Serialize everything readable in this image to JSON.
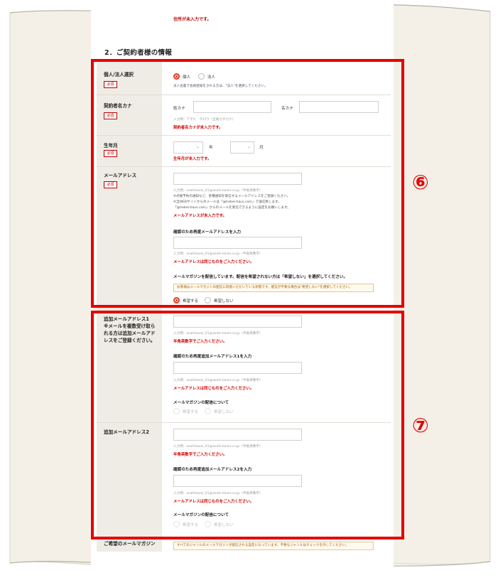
{
  "top_error": "住所が未入力です。",
  "section_title": "2．ご契約者様の情報",
  "required_label": "必須",
  "rows": {
    "type": {
      "label": "個人/法人選択",
      "options": [
        "個人",
        "法人"
      ],
      "selected": "個人",
      "note": "法人名義で会員登録をされる方は、\"法人\"を選択してください。"
    },
    "kana": {
      "label": "契約者名カナ",
      "sei_label": "姓カナ",
      "mei_label": "名カナ",
      "hint": "入力例：アサヒ　タロウ（全角カタカナ）",
      "error": "契約者名カナが未入力です。"
    },
    "birth": {
      "label": "生年月",
      "year_unit": "年",
      "month_unit": "月",
      "error": "生年月が未入力です。"
    },
    "email": {
      "label": "メールアドレス",
      "hint": "入力例：asahikasei_01@asahi-kasei.co.jp（半角英数字）",
      "notes": [
        "※点検予約の通知など、各種通知を受信するメールアドレスをご登録ください。",
        "※当WEBサイトからのメールは「@hebel-haus.com」で送信致します。",
        "「@hebel-haus.com」からのメールを受信できるように設定をお願いします。"
      ],
      "error": "メールアドレスが未入力です。",
      "confirm_label": "確認のため再度メールアドレスを入力",
      "confirm_hint": "入力例：asahikasei_01@asahi-kasei.co.jp（半角英数字）",
      "confirm_error": "メールアドレスは同じものをご入力ください。",
      "magazine_label": "メールマガジンを配信しています。配信を希望されない方は「希望しない」を選択してください。",
      "magazine_notice": "お客様はメールマガジンの配信に同意いただいている状態です。配信が不要な場合は\"希望しない\"を選択してください。",
      "magazine_options": [
        "希望する",
        "希望しない"
      ],
      "magazine_selected": "希望する"
    },
    "extra1": {
      "label_lines": [
        "追加メールアドレス1",
        "※メールを複数受け取ら",
        "れる方は追加メールアド",
        "レスをご登録ください。"
      ],
      "hint": "入力例：asahikasei_01@asahi-kasei.co.jp（半角英数字）",
      "error": "半角英数字でご入力ください。",
      "confirm_label": "確認のため再度追加メールアドレス1を入力",
      "confirm_hint": "入力例：asahikasei_01@asahi-kasei.co.jp（半角英数字）",
      "confirm_error": "メールアドレスは同じものをご入力ください。",
      "magazine_label": "メールマガジンの配信について",
      "magazine_options": [
        "希望する",
        "希望しない"
      ]
    },
    "extra2": {
      "label": "追加メールアドレス2",
      "hint": "入力例：asahikasei_01@asahi-kasei.co.jp（半角英数字）",
      "error": "半角英数字でご入力ください。",
      "confirm_label": "確認のため再度追加メールアドレス2を入力",
      "confirm_hint": "入力例：asahikasei_01@asahi-kasei.co.jp（半角英数字）",
      "confirm_error": "メールアドレスは同じものをご入力ください。",
      "magazine_label": "メールマガジンの配信について",
      "magazine_options": [
        "希望する",
        "希望しない"
      ]
    },
    "magazine_row": {
      "label": "ご希望のメールマガジン",
      "notice": "すべてのジャンルのメールマガジンが配信される設定になっています。不要なジャンルはチェックを外してください。"
    }
  },
  "annotations": {
    "frame6_label": "⑥",
    "frame7_label": "⑦",
    "color": "#e60000"
  }
}
